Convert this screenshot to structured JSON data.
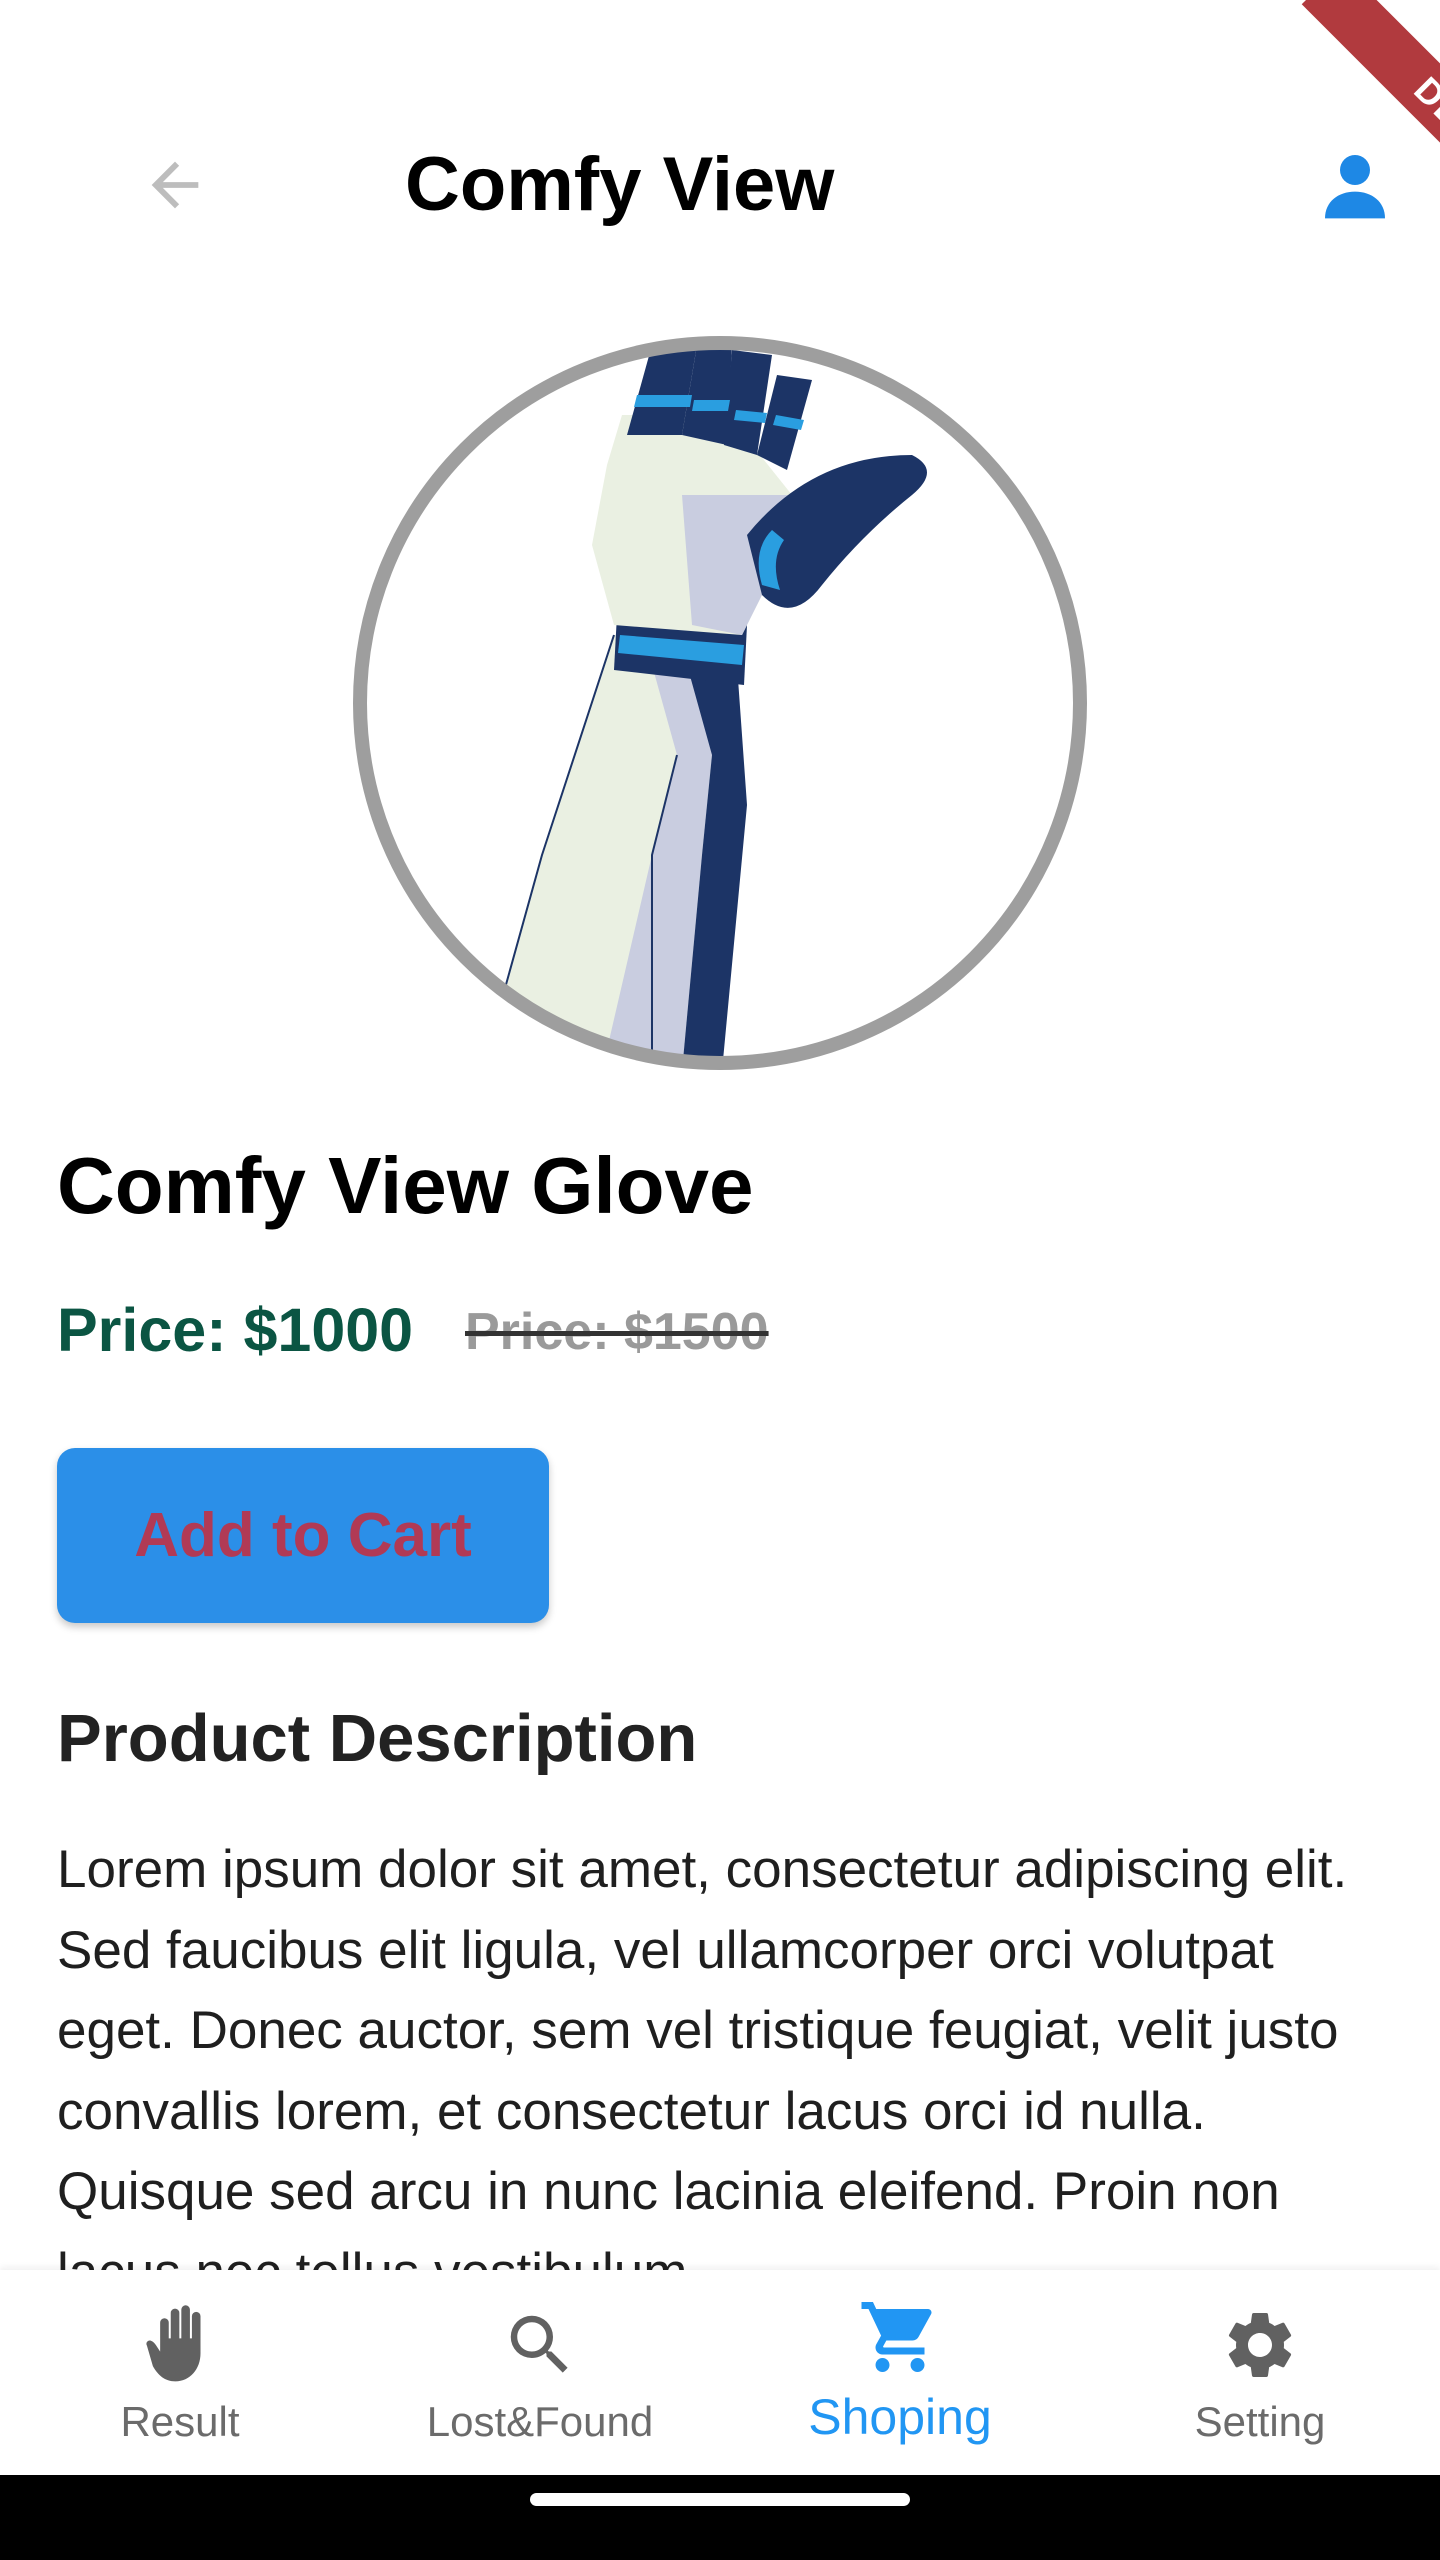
{
  "app_bar": {
    "title": "Comfy View",
    "back_icon": "arrow-left-icon",
    "profile_icon": "person-icon"
  },
  "debug_banner": {
    "label": "DEBUG"
  },
  "product": {
    "image_icon": "robotic-glove-image",
    "title": "Comfy View Glove",
    "price_current": "Price: $1000",
    "price_old": "Price: $1500",
    "add_to_cart_label": "Add to Cart",
    "description_heading": "Product Description",
    "description": "Lorem ipsum dolor sit amet, consectetur adipiscing elit. Sed faucibus elit ligula, vel ullamcorper orci volutpat eget. Donec auctor, sem vel tristique feugiat, velit justo convallis lorem, et consectetur lacus orci id nulla. Quisque sed arcu in nunc lacinia eleifend. Proin non lacus nec tellus vestibulum"
  },
  "bottom_nav": {
    "items": [
      {
        "label": "Result",
        "icon": "hand-icon",
        "active": false
      },
      {
        "label": "Lost&Found",
        "icon": "search-icon",
        "active": false
      },
      {
        "label": "Shoping",
        "icon": "cart-icon",
        "active": true
      },
      {
        "label": "Setting",
        "icon": "gear-icon",
        "active": false
      }
    ]
  },
  "colors": {
    "accent": "#2196f3",
    "button_bg": "#2b8fe8",
    "button_text": "#b13a55",
    "price_current": "#0b5543",
    "price_old": "#9a9a9a",
    "debug_banner": "#b13a3e"
  }
}
